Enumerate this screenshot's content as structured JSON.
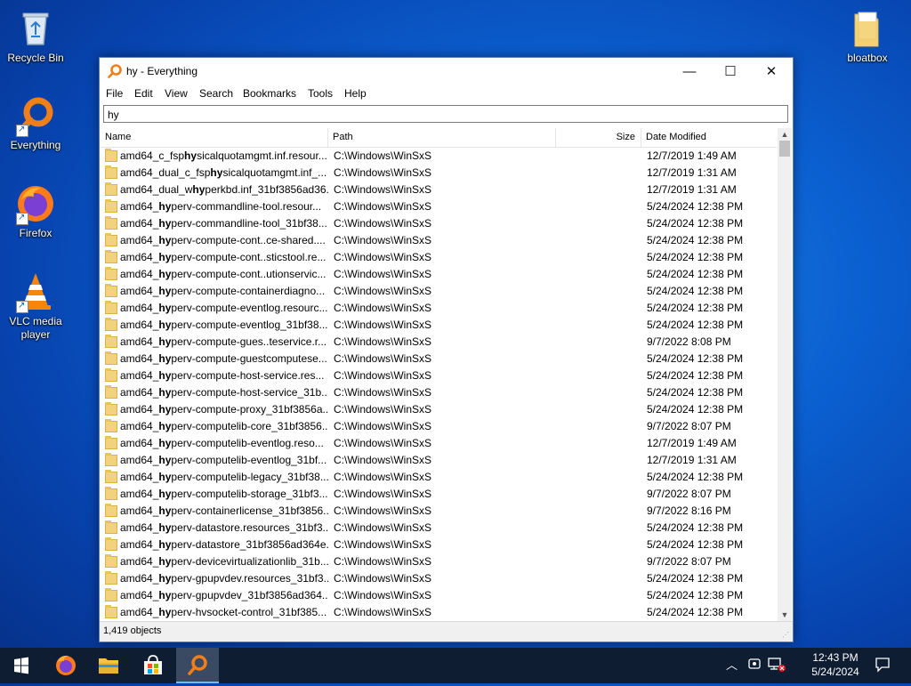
{
  "desktop": {
    "icons": [
      {
        "label": "Recycle Bin"
      },
      {
        "label": "Everything"
      },
      {
        "label": "Firefox"
      },
      {
        "label": "VLC media player"
      },
      {
        "label": "bloatbox"
      }
    ]
  },
  "window": {
    "title": "hy - Everything",
    "controls": {
      "minimize": "—",
      "maximize": "☐",
      "close": "✕"
    },
    "menu": [
      "File",
      "Edit",
      "View",
      "Search",
      "Bookmarks",
      "Tools",
      "Help"
    ],
    "search": {
      "value": "hy"
    },
    "columns": {
      "name": "Name",
      "path": "Path",
      "size": "Size",
      "date": "Date Modified"
    },
    "rows": [
      {
        "name": "amd64_c_fsphysicalquotamgmt.inf.resour...",
        "path": "C:\\Windows\\WinSxS",
        "date": "12/7/2019 1:49 AM"
      },
      {
        "name": "amd64_dual_c_fsphysicalquotamgmt.inf_...",
        "path": "C:\\Windows\\WinSxS",
        "date": "12/7/2019 1:31 AM"
      },
      {
        "name": "amd64_dual_whyperkbd.inf_31bf3856ad36...",
        "path": "C:\\Windows\\WinSxS",
        "date": "12/7/2019 1:31 AM"
      },
      {
        "name": "amd64_hyperv-commandline-tool.resour...",
        "path": "C:\\Windows\\WinSxS",
        "date": "5/24/2024 12:38 PM"
      },
      {
        "name": "amd64_hyperv-commandline-tool_31bf38...",
        "path": "C:\\Windows\\WinSxS",
        "date": "5/24/2024 12:38 PM"
      },
      {
        "name": "amd64_hyperv-compute-cont..ce-shared....",
        "path": "C:\\Windows\\WinSxS",
        "date": "5/24/2024 12:38 PM"
      },
      {
        "name": "amd64_hyperv-compute-cont..sticstool.re...",
        "path": "C:\\Windows\\WinSxS",
        "date": "5/24/2024 12:38 PM"
      },
      {
        "name": "amd64_hyperv-compute-cont..utionservic...",
        "path": "C:\\Windows\\WinSxS",
        "date": "5/24/2024 12:38 PM"
      },
      {
        "name": "amd64_hyperv-compute-containerdiagno...",
        "path": "C:\\Windows\\WinSxS",
        "date": "5/24/2024 12:38 PM"
      },
      {
        "name": "amd64_hyperv-compute-eventlog.resourc...",
        "path": "C:\\Windows\\WinSxS",
        "date": "5/24/2024 12:38 PM"
      },
      {
        "name": "amd64_hyperv-compute-eventlog_31bf38...",
        "path": "C:\\Windows\\WinSxS",
        "date": "5/24/2024 12:38 PM"
      },
      {
        "name": "amd64_hyperv-compute-gues..teservice.r...",
        "path": "C:\\Windows\\WinSxS",
        "date": "9/7/2022 8:08 PM"
      },
      {
        "name": "amd64_hyperv-compute-guestcomputese...",
        "path": "C:\\Windows\\WinSxS",
        "date": "5/24/2024 12:38 PM"
      },
      {
        "name": "amd64_hyperv-compute-host-service.res...",
        "path": "C:\\Windows\\WinSxS",
        "date": "5/24/2024 12:38 PM"
      },
      {
        "name": "amd64_hyperv-compute-host-service_31b...",
        "path": "C:\\Windows\\WinSxS",
        "date": "5/24/2024 12:38 PM"
      },
      {
        "name": "amd64_hyperv-compute-proxy_31bf3856a...",
        "path": "C:\\Windows\\WinSxS",
        "date": "5/24/2024 12:38 PM"
      },
      {
        "name": "amd64_hyperv-computelib-core_31bf3856...",
        "path": "C:\\Windows\\WinSxS",
        "date": "9/7/2022 8:07 PM"
      },
      {
        "name": "amd64_hyperv-computelib-eventlog.reso...",
        "path": "C:\\Windows\\WinSxS",
        "date": "12/7/2019 1:49 AM"
      },
      {
        "name": "amd64_hyperv-computelib-eventlog_31bf...",
        "path": "C:\\Windows\\WinSxS",
        "date": "12/7/2019 1:31 AM"
      },
      {
        "name": "amd64_hyperv-computelib-legacy_31bf38...",
        "path": "C:\\Windows\\WinSxS",
        "date": "5/24/2024 12:38 PM"
      },
      {
        "name": "amd64_hyperv-computelib-storage_31bf3...",
        "path": "C:\\Windows\\WinSxS",
        "date": "9/7/2022 8:07 PM"
      },
      {
        "name": "amd64_hyperv-containerlicense_31bf3856...",
        "path": "C:\\Windows\\WinSxS",
        "date": "9/7/2022 8:16 PM"
      },
      {
        "name": "amd64_hyperv-datastore.resources_31bf3...",
        "path": "C:\\Windows\\WinSxS",
        "date": "5/24/2024 12:38 PM"
      },
      {
        "name": "amd64_hyperv-datastore_31bf3856ad364e...",
        "path": "C:\\Windows\\WinSxS",
        "date": "5/24/2024 12:38 PM"
      },
      {
        "name": "amd64_hyperv-devicevirtualizationlib_31b...",
        "path": "C:\\Windows\\WinSxS",
        "date": "9/7/2022 8:07 PM"
      },
      {
        "name": "amd64_hyperv-gpupvdev.resources_31bf3...",
        "path": "C:\\Windows\\WinSxS",
        "date": "5/24/2024 12:38 PM"
      },
      {
        "name": "amd64_hyperv-gpupvdev_31bf3856ad364...",
        "path": "C:\\Windows\\WinSxS",
        "date": "5/24/2024 12:38 PM"
      },
      {
        "name": "amd64_hyperv-hvsocket-control_31bf385...",
        "path": "C:\\Windows\\WinSxS",
        "date": "5/24/2024 12:38 PM"
      }
    ],
    "status": "1,419 objects"
  },
  "taskbar": {
    "clock_time": "12:43 PM",
    "clock_date": "5/24/2024",
    "accent": "#76b9ed"
  }
}
